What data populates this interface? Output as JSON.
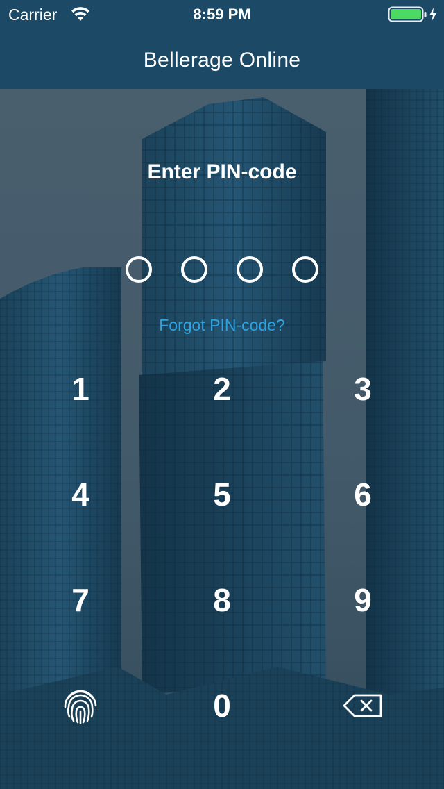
{
  "status_bar": {
    "carrier": "Carrier",
    "time": "8:59 PM"
  },
  "nav": {
    "title": "Bellerage Online"
  },
  "pin": {
    "prompt": "Enter PIN-code",
    "digits_total": 4,
    "digits_entered": 0,
    "forgot_label": "Forgot PIN-code?"
  },
  "keypad": {
    "k1": "1",
    "k2": "2",
    "k3": "3",
    "k4": "4",
    "k5": "5",
    "k6": "6",
    "k7": "7",
    "k8": "8",
    "k9": "9",
    "k0": "0",
    "left_icon": "fingerprint-icon",
    "right_icon": "backspace-icon"
  },
  "colors": {
    "nav_background": "#1c4a66",
    "accent_link": "#2fa3e0",
    "battery": "#4cd964"
  }
}
